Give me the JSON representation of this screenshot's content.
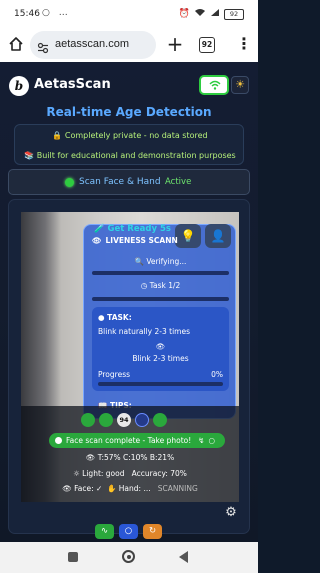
{
  "status_bar": {
    "time": "15:46",
    "left_icons": "○ …",
    "battery": "92"
  },
  "browser": {
    "url": "aetasscan.com",
    "tab_count": "92"
  },
  "app": {
    "name": "AetasScan",
    "logo_letter": "b",
    "headline": "Real-time Age Detection",
    "info_line1": "🔒 Completely private - no data stored",
    "info_line2": "📚 Built for educational and demonstration purposes",
    "mode_label": "Scan Face & Hand",
    "mode_status": "Active",
    "accent_color": "#5aa9ff",
    "active_color": "#2ecc40"
  },
  "liveness": {
    "get_ready": "Get Ready 5s",
    "title": "LIVENESS SCANN",
    "verifying": "🔍 Verifying...",
    "task_step": "Task 1/2",
    "task_heading": "TASK:",
    "task_text": "Blink naturally 2-3 times",
    "task_text2": "Blink 2-3 times",
    "progress_label": "Progress",
    "progress_value": "0%",
    "progress_fraction": 0.0,
    "tips_heading": "TIPS:"
  },
  "camera_overlay": {
    "score_badge": "94",
    "complete_text": "Face scan complete - Take photo!",
    "stats": "T:57%   C:10%   B:21%",
    "light": "Light: good",
    "accuracy": "Accuracy: 70%",
    "face_label": "Face: ✓",
    "hand_label": "Hand: ...",
    "scanning": "SCANNING"
  }
}
